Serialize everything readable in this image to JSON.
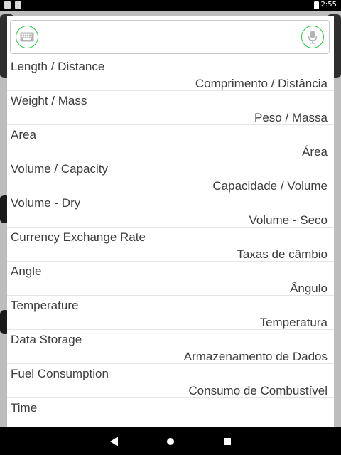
{
  "status_bar": {
    "time": "2:55",
    "icons": [
      "sd-card-icon",
      "image-icon",
      "battery-icon"
    ]
  },
  "search": {
    "value": "",
    "placeholder": "",
    "left_icon": "keyboard-icon",
    "right_icon": "microphone-icon"
  },
  "list": {
    "items": [
      {
        "en": "Length / Distance",
        "pt": "Comprimento / Distância"
      },
      {
        "en": "Weight / Mass",
        "pt": "Peso / Massa"
      },
      {
        "en": "Area",
        "pt": "Área"
      },
      {
        "en": "Volume / Capacity",
        "pt": "Capacidade / Volume"
      },
      {
        "en": "Volume - Dry",
        "pt": "Volume - Seco"
      },
      {
        "en": "Currency Exchange Rate",
        "pt": "Taxas de câmbio"
      },
      {
        "en": "Angle",
        "pt": "Ângulo"
      },
      {
        "en": "Temperature",
        "pt": "Temperatura"
      },
      {
        "en": "Data Storage",
        "pt": "Armazenamento de Dados"
      },
      {
        "en": "Fuel Consumption",
        "pt": "Consumo de Combustível"
      },
      {
        "en": "Time",
        "pt": ""
      }
    ]
  },
  "nav": {
    "icons": [
      "back-icon",
      "home-icon",
      "recents-icon"
    ]
  },
  "colors": {
    "accent": "#27c93f",
    "text": "#3d3d3d",
    "divider": "#e6e6e6"
  }
}
